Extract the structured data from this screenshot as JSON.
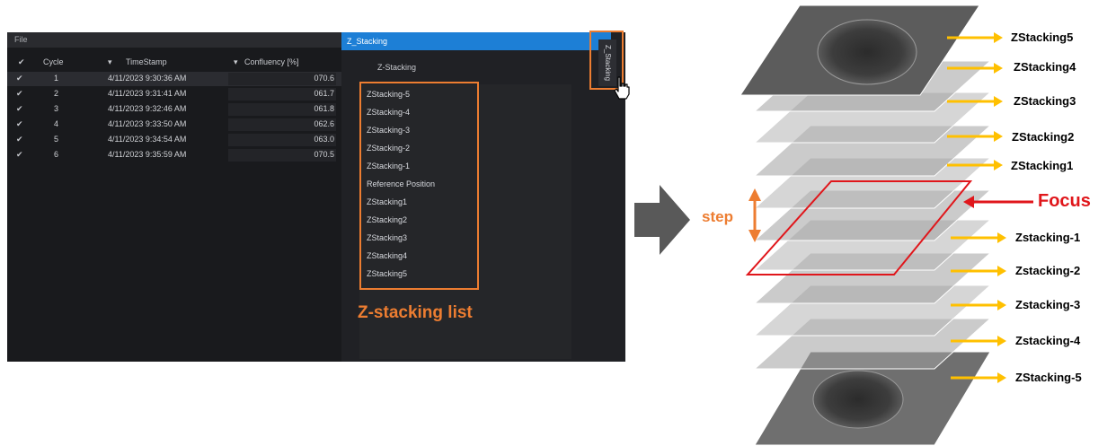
{
  "app": {
    "title": "File",
    "columns": [
      "Cycle",
      "TimeStamp",
      "Confluency [%]"
    ],
    "rows": [
      {
        "cycle": "1",
        "timestamp": "4/11/2023 9:30:36 AM",
        "value": "070.6"
      },
      {
        "cycle": "2",
        "timestamp": "4/11/2023 9:31:41 AM",
        "value": "061.7"
      },
      {
        "cycle": "3",
        "timestamp": "4/11/2023 9:32:46 AM",
        "value": "061.8"
      },
      {
        "cycle": "4",
        "timestamp": "4/11/2023 9:33:50 AM",
        "value": "062.6"
      },
      {
        "cycle": "5",
        "timestamp": "4/11/2023 9:34:54 AM",
        "value": "063.0"
      },
      {
        "cycle": "6",
        "timestamp": "4/11/2023 9:35:59 AM",
        "value": "070.5"
      }
    ]
  },
  "zpanel": {
    "header": "Z_Stacking",
    "subtitle": "Z-Stacking",
    "vertical_tab": "Z_Stacking",
    "items": [
      "ZStacking-5",
      "ZStacking-4",
      "ZStacking-3",
      "ZStacking-2",
      "ZStacking-1",
      "Reference Position",
      "ZStacking1",
      "ZStacking2",
      "ZStacking3",
      "ZStacking4",
      "ZStacking5"
    ]
  },
  "annotation": {
    "list_label": "Z-stacking  list"
  },
  "diagram": {
    "step_label": "step",
    "focus_label": "Focus",
    "labels_top": [
      "ZStacking5",
      "ZStacking4",
      "ZStacking3",
      "ZStacking2",
      "ZStacking1"
    ],
    "labels_bottom": [
      "Zstacking-1",
      "Zstacking-2",
      "Zstacking-3",
      "Zstacking-4",
      "ZStacking-5"
    ]
  },
  "colors": {
    "accent_blue": "#1d7fd6",
    "annotation_orange": "#ed7d31",
    "arrow_yellow": "#ffc000",
    "focus_red": "#e0161b",
    "big_arrow_gray": "#595959"
  }
}
